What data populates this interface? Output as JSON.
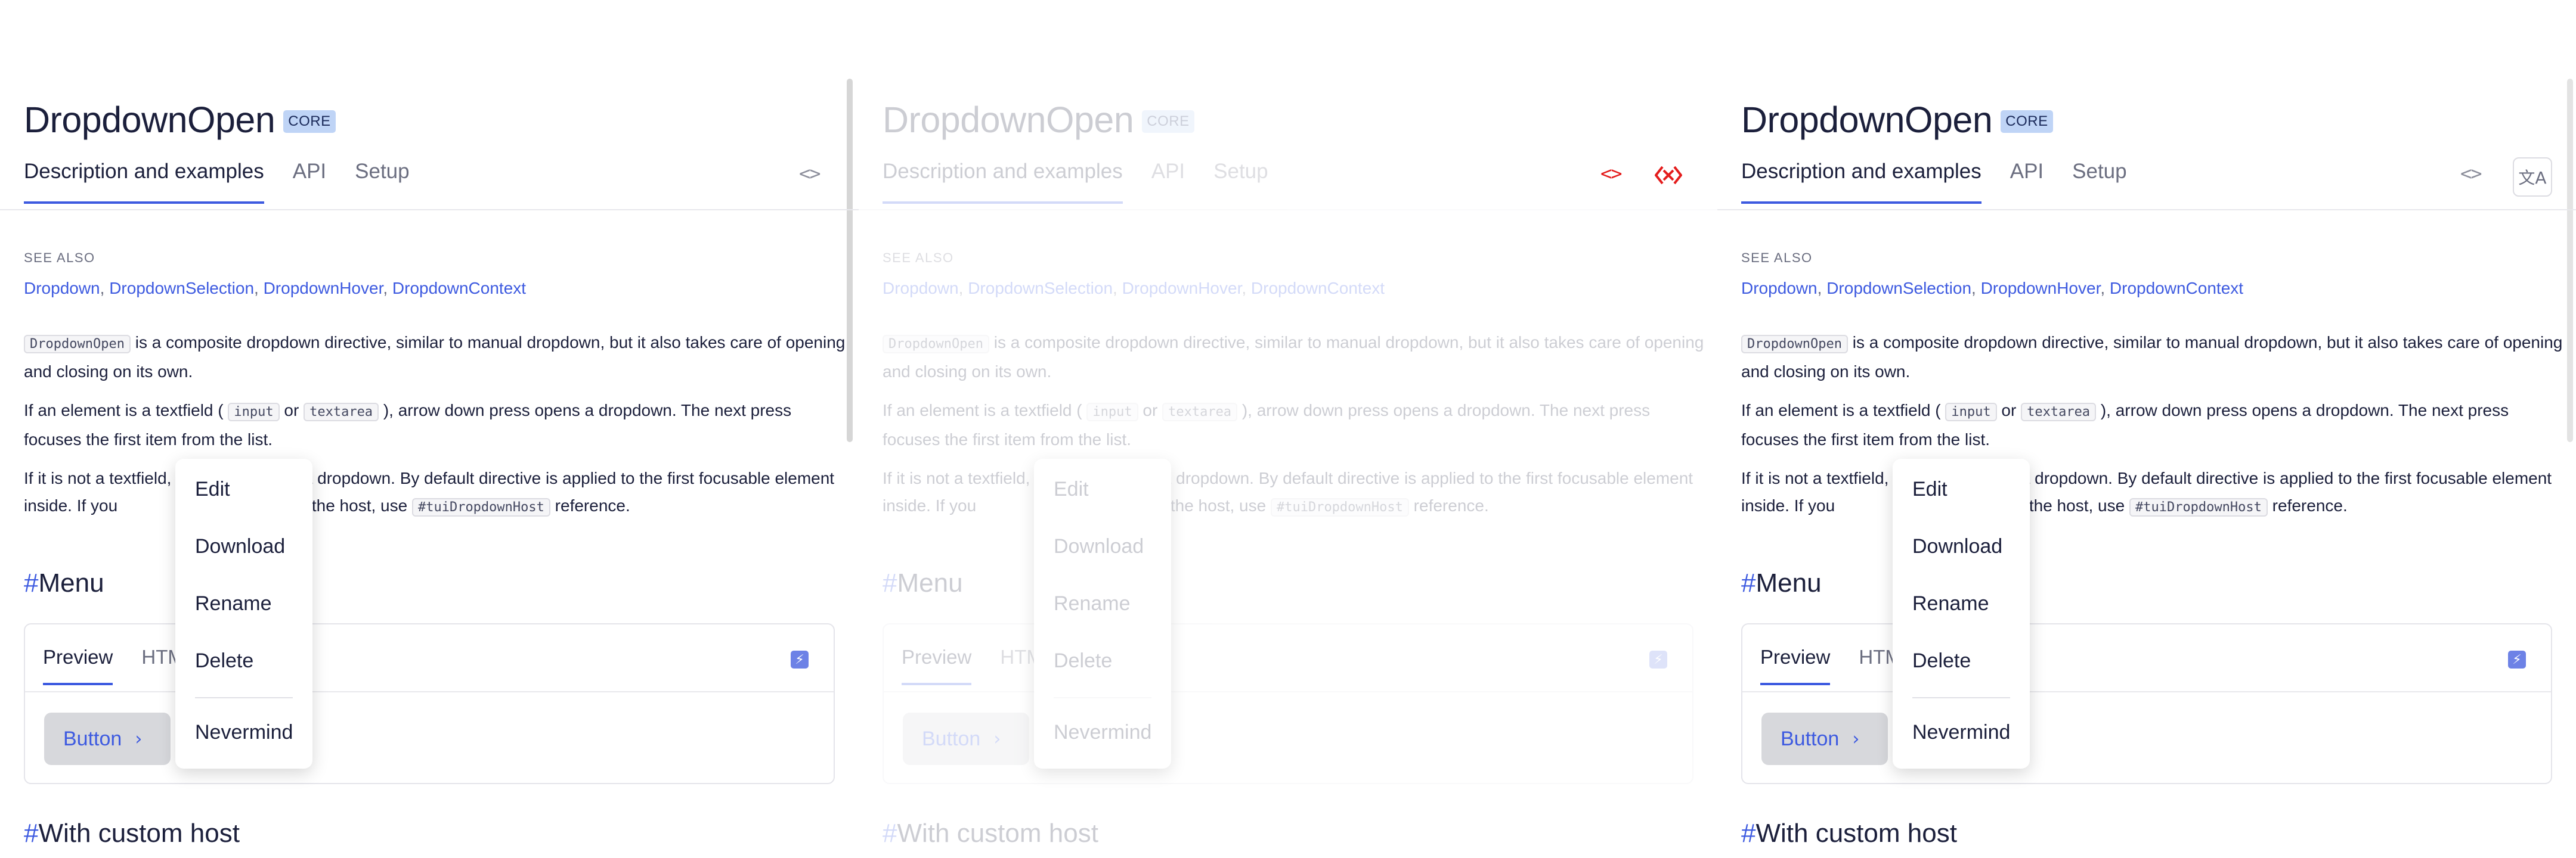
{
  "page": {
    "title": "DropdownOpen",
    "badge": "CORE",
    "tabs": [
      "Description and examples",
      "API",
      "Setup"
    ],
    "code_icon": "<>",
    "lang_icon": "文A"
  },
  "see_also": {
    "label": "SEE ALSO",
    "links": [
      "Dropdown",
      "DropdownSelection",
      "DropdownHover",
      "DropdownContext"
    ],
    "separator": ", "
  },
  "paragraphs": {
    "p1_code": "DropdownOpen",
    "p1_text": " is a composite dropdown directive, similar to manual dropdown, but it also takes care of opening and closing on its own.",
    "p2_pre": "If an element is a textfield ( ",
    "p2_code1": "input",
    "p2_mid": " or ",
    "p2_code2": "textarea",
    "p2_post": " ), arrow down press opens a dropdown. The next press focuses the first item from the list.",
    "p3_pre_a": "If it is not a textfield,",
    "p3_pre_b": "ses a dropdown. By default directive is applied to the first focusable element inside. If you",
    "p3_mid": "ement to be the host, use ",
    "p3_code": "#tuiDropdownHost",
    "p3_post": " reference."
  },
  "sections": {
    "menu_heading": "Menu",
    "host_heading": "With custom host",
    "hash": "#"
  },
  "example": {
    "tabs": [
      "Preview",
      "HTM"
    ],
    "tab_tail": "t",
    "button_label": "Button",
    "button_chevron": "›",
    "bolt": "⚡"
  },
  "dropdown": {
    "items": [
      "Edit",
      "Download",
      "Rename",
      "Delete"
    ],
    "cancel": "Nevermind"
  },
  "colors": {
    "accent": "#3d5ae0",
    "badge_bg": "#bfd4f6",
    "code_icon_active": "#e41c1c"
  }
}
